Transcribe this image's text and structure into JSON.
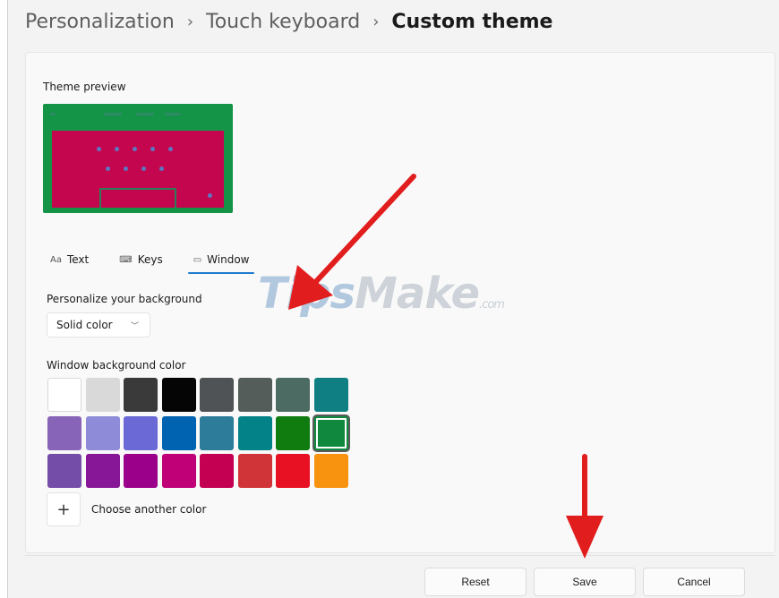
{
  "breadcrumb": {
    "items": [
      "Personalization",
      "Touch keyboard",
      "Custom theme"
    ],
    "separator": "›"
  },
  "preview": {
    "label": "Theme preview",
    "frame_color": "#149447",
    "keyboard_color": "#c4064e"
  },
  "tabs": [
    {
      "icon": "Aa",
      "label": "Text",
      "active": false
    },
    {
      "icon": "⌨",
      "label": "Keys",
      "active": false
    },
    {
      "icon": "▭",
      "label": "Window",
      "active": true
    }
  ],
  "background": {
    "label": "Personalize your background",
    "selected": "Solid color"
  },
  "color_section": {
    "label": "Window background color",
    "colors": [
      [
        "#ffffff",
        "#d9d9d9",
        "#3a3a3a",
        "#050505",
        "#4f5355",
        "#545d59",
        "#4b6b63",
        "#0f7f84"
      ],
      [
        "#8764b8",
        "#8e8cd8",
        "#6b69d6",
        "#0063b1",
        "#2d7d9a",
        "#038387",
        "#107c10",
        "#10893e"
      ],
      [
        "#744da9",
        "#881798",
        "#9a0089",
        "#bf0077",
        "#c30052",
        "#d13438",
        "#e81123",
        "#f7930f"
      ]
    ],
    "selected_color": "#10893e",
    "choose_label": "Choose another color"
  },
  "footer": {
    "reset": "Reset",
    "save": "Save",
    "cancel": "Cancel"
  },
  "watermark": {
    "brand_prefix": "Tips",
    "brand_rest": "Make",
    "suffix": ".com"
  },
  "annotation_color": "#e21d1d"
}
